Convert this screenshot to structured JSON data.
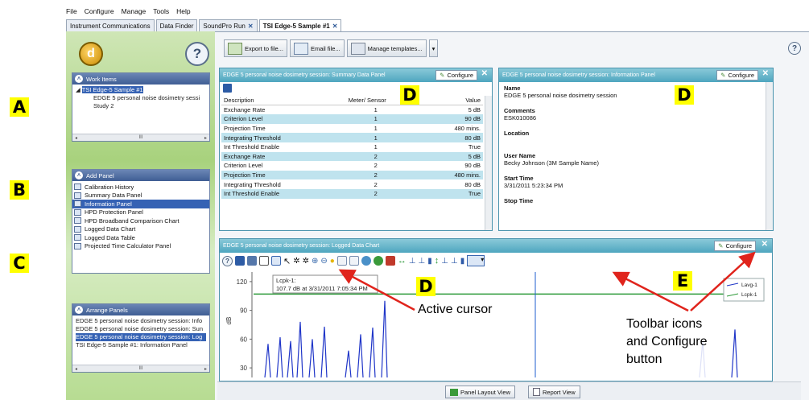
{
  "callouts": {
    "a": "A",
    "b": "B",
    "c": "C",
    "d1": "D",
    "d2": "D",
    "d3": "D",
    "e": "E"
  },
  "menu": [
    "File",
    "Configure",
    "Manage",
    "Tools",
    "Help"
  ],
  "tabs": [
    {
      "label": "Instrument Communications",
      "close": false
    },
    {
      "label": "Data Finder",
      "close": false
    },
    {
      "label": "SoundPro Run",
      "close": true
    },
    {
      "label": "TSI Edge-5 Sample #1",
      "close": true
    }
  ],
  "left": {
    "logo_letter": "d",
    "help": "?",
    "work_items": {
      "title": "Work Items",
      "items": [
        "TSI Edge-5 Sample #1",
        "EDGE 5 personal noise dosimetry sessi",
        "Study 2"
      ]
    },
    "add_panel": {
      "title": "Add Panel",
      "items": [
        "Calibration History",
        "Summary Data Panel",
        "Information Panel",
        "HPD Protection Panel",
        "HPD Broadband Comparison Chart",
        "Logged Data Chart",
        "Logged Data Table",
        "Projected Time Calculator Panel"
      ],
      "selected": 2
    },
    "arrange": {
      "title": "Arrange Panels",
      "items": [
        "EDGE 5 personal noise dosimetry session: Info",
        "EDGE 5 personal noise dosimetry session: Sun",
        "EDGE 5 personal noise dosimetry session: Log",
        "TSI Edge-5 Sample #1: Information Panel"
      ],
      "selected": 2
    },
    "scroll_mark": "III"
  },
  "toolbar": {
    "export": "Export to file...",
    "email": "Email file...",
    "templates": "Manage templates..."
  },
  "summary": {
    "title": "EDGE 5 personal noise dosimetry session: Summary Data Panel",
    "configure": "Configure",
    "headers": [
      "Description",
      "Meter/ Sensor",
      "Value"
    ],
    "rows": [
      [
        "Exchange Rate",
        "1",
        "5 dB"
      ],
      [
        "Criterion Level",
        "1",
        "90 dB"
      ],
      [
        "Projection Time",
        "1",
        "480 mins."
      ],
      [
        "Integrating Threshold",
        "1",
        "80 dB"
      ],
      [
        "Int Threshold Enable",
        "1",
        "True"
      ],
      [
        "Exchange Rate",
        "2",
        "5 dB"
      ],
      [
        "Criterion Level",
        "2",
        "90 dB"
      ],
      [
        "Projection Time",
        "2",
        "480 mins."
      ],
      [
        "Integrating Threshold",
        "2",
        "80 dB"
      ],
      [
        "Int Threshold Enable",
        "2",
        "True"
      ]
    ]
  },
  "info": {
    "title": "EDGE 5 personal noise dosimetry session: Information Panel",
    "configure": "Configure",
    "fields": [
      {
        "label": "Name",
        "value": "EDGE 5 personal noise dosimetry session"
      },
      {
        "label": "Comments",
        "value": "ESK010086"
      },
      {
        "label": "Location",
        "value": ""
      },
      {
        "label": "User Name",
        "value": "Becky Johnson (3M Sample Name)"
      },
      {
        "label": "Start Time",
        "value": "3/31/2011 5:23:34 PM"
      },
      {
        "label": "Stop Time",
        "value": ""
      }
    ]
  },
  "chart_panel": {
    "title": "EDGE 5 personal noise dosimetry session: Logged Data Chart",
    "configure": "Configure",
    "cursor_label": "Lcpk-1:",
    "cursor_value": "107.7 dB at 3/31/2011 7:05:34 PM",
    "legend": [
      "Lavg-1",
      "Lcpk-1"
    ],
    "colors": {
      "lavg": "#1f35c8",
      "lcpk": "#2e9a3a"
    }
  },
  "chart_data": {
    "type": "line",
    "ylabel": "dB",
    "yticks": [
      30,
      60,
      90,
      120
    ],
    "ylim": [
      20,
      130
    ],
    "series": [
      {
        "name": "Lavg-1",
        "values": [
          55,
          62,
          58,
          78,
          60,
          73,
          48,
          65,
          72,
          100,
          58,
          70
        ]
      },
      {
        "name": "Lcpk-1",
        "values": [
          107,
          107,
          107,
          107,
          107,
          107,
          107,
          107,
          107,
          107,
          107,
          107
        ]
      }
    ]
  },
  "annotations": {
    "active_cursor": "Active cursor",
    "toolbar_text": "Toolbar icons\nand Configure\nbutton"
  },
  "bottom": {
    "layout": "Panel Layout View",
    "report": "Report View"
  }
}
